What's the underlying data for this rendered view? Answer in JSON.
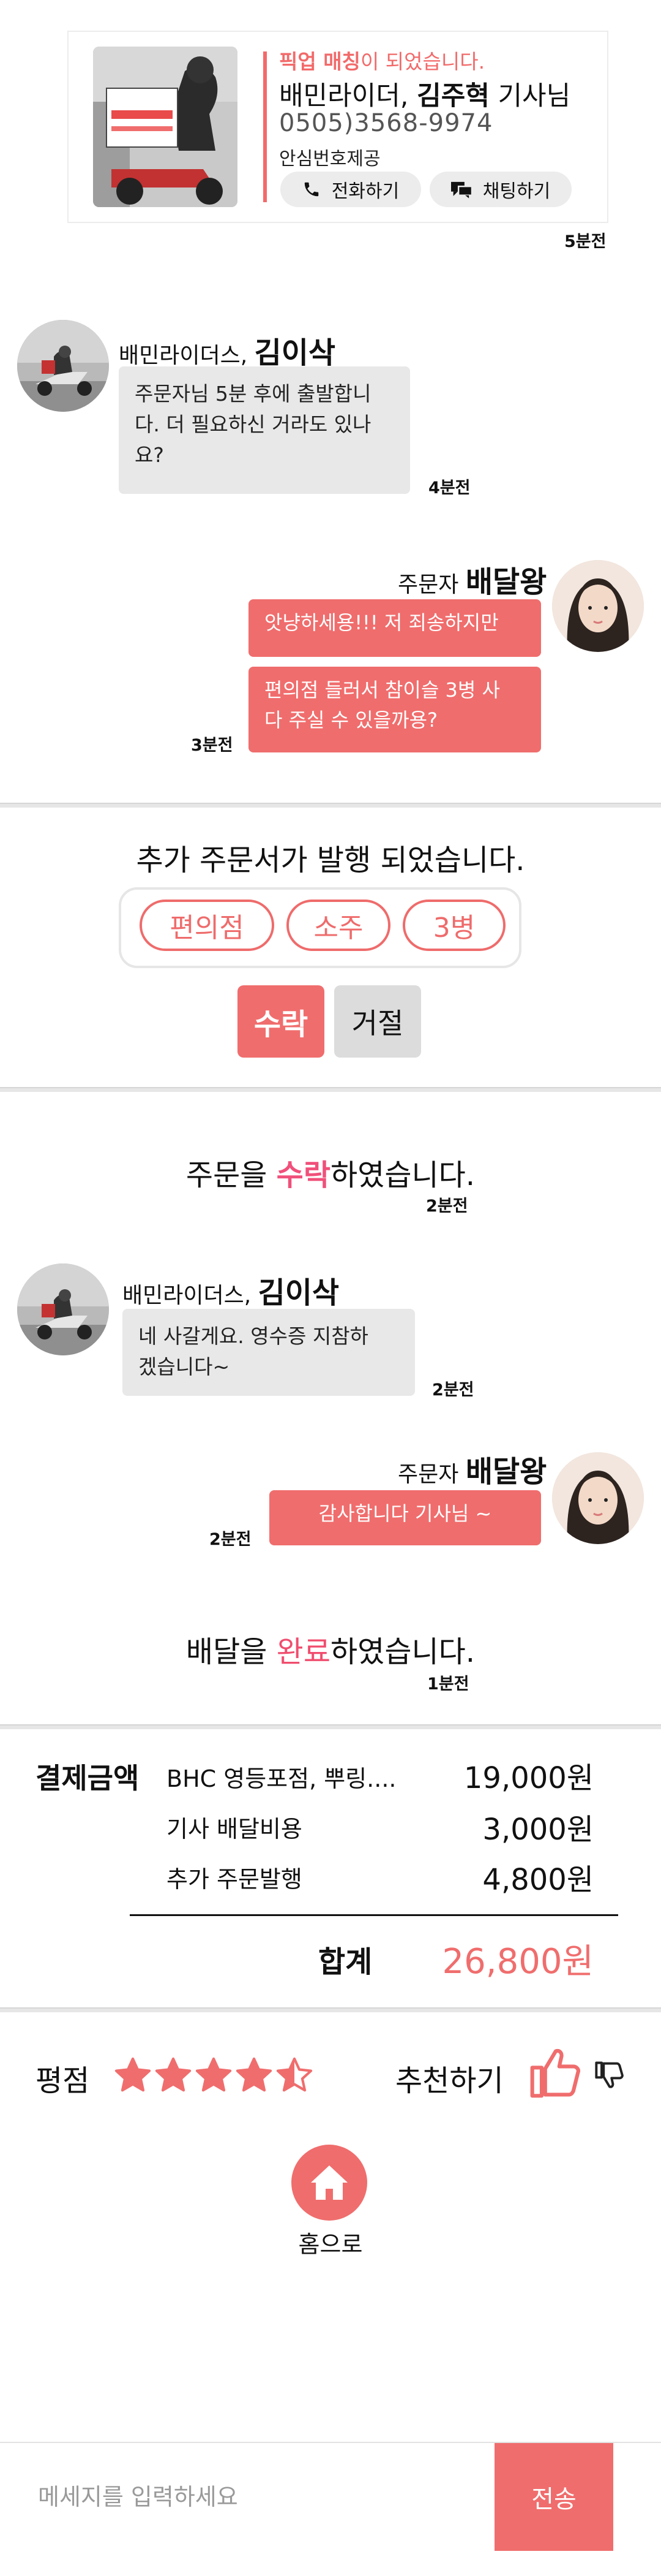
{
  "match_card": {
    "title_highlight": "픽업 매칭",
    "title_rest": "이 되었습니다.",
    "rider_company": "배민라이더, ",
    "rider_name": "김주혁",
    "rider_suffix": " 기사님",
    "phone": "0505)3568-9974",
    "safe_number_label": "안심번호제공",
    "call_button": "전화하기",
    "chat_button": "채팅하기",
    "photo_box_text": "배달의민족\n031-771-7982",
    "time": "5분전"
  },
  "messages": [
    {
      "side": "left",
      "sender_prefix": "배민라이더스, ",
      "sender_name": "김이삭",
      "lines": [
        "주문자님 5분 후에 출발합니",
        "다. 더 필요하신 거라도 있나",
        "요?"
      ],
      "time": "4분전"
    },
    {
      "side": "right",
      "sender_prefix": "주문자 ",
      "sender_name": "배달왕",
      "bubbles": [
        {
          "lines": [
            "앗냥하세용!!! 저 죄송하지만"
          ]
        },
        {
          "lines": [
            "편의점 들러서 참이슬 3병 사",
            "다 주실 수 있을까용?"
          ]
        }
      ],
      "time": "3분전"
    }
  ],
  "additional_order": {
    "title": "추가 주문서가 발행 되었습니다.",
    "items": [
      "편의점",
      "소주",
      "3병"
    ],
    "accept_label": "수락",
    "reject_label": "거절"
  },
  "accepted_notice": {
    "prefix": "주문을 ",
    "highlight": "수락",
    "suffix": "하였습니다.",
    "time": "2분전"
  },
  "messages2": [
    {
      "side": "left",
      "sender_prefix": "배민라이더스, ",
      "sender_name": "김이삭",
      "lines": [
        "네 사갈게요. 영수증 지참하",
        "겠습니다~"
      ],
      "time": "2분전"
    },
    {
      "side": "right",
      "sender_prefix": "주문자 ",
      "sender_name": "배달왕",
      "lines": [
        "감사합니다 기사님 ~"
      ],
      "time": "2분전"
    }
  ],
  "delivered_notice": {
    "prefix": "배달을 ",
    "highlight": "완료",
    "suffix": "하였습니다.",
    "time": "1분전"
  },
  "payment": {
    "title": "결제금액",
    "rows": [
      {
        "label": "BHC 영등포점, 뿌링....",
        "amount": "19,000원"
      },
      {
        "label": "기사 배달비용",
        "amount": "3,000원"
      },
      {
        "label": "추가 주문발행",
        "amount": "4,800원"
      }
    ],
    "total_label": "합계",
    "total_amount": "26,800원"
  },
  "rating": {
    "label": "평점",
    "stars": 4.5,
    "max_stars": 5,
    "recommend_label": "추천하기",
    "like_icon": "thumbs-up-icon",
    "dislike_icon": "thumbs-down-icon"
  },
  "home": {
    "label": "홈으로",
    "icon": "home-icon"
  },
  "input_bar": {
    "placeholder": "메세지를 입력하세요",
    "send_label": "전송"
  },
  "colors": {
    "accent": "#f06d6d",
    "highlight_text": "#f0507a",
    "bubble_gray": "#e8e8e8",
    "divider": "#e6e6e6"
  }
}
